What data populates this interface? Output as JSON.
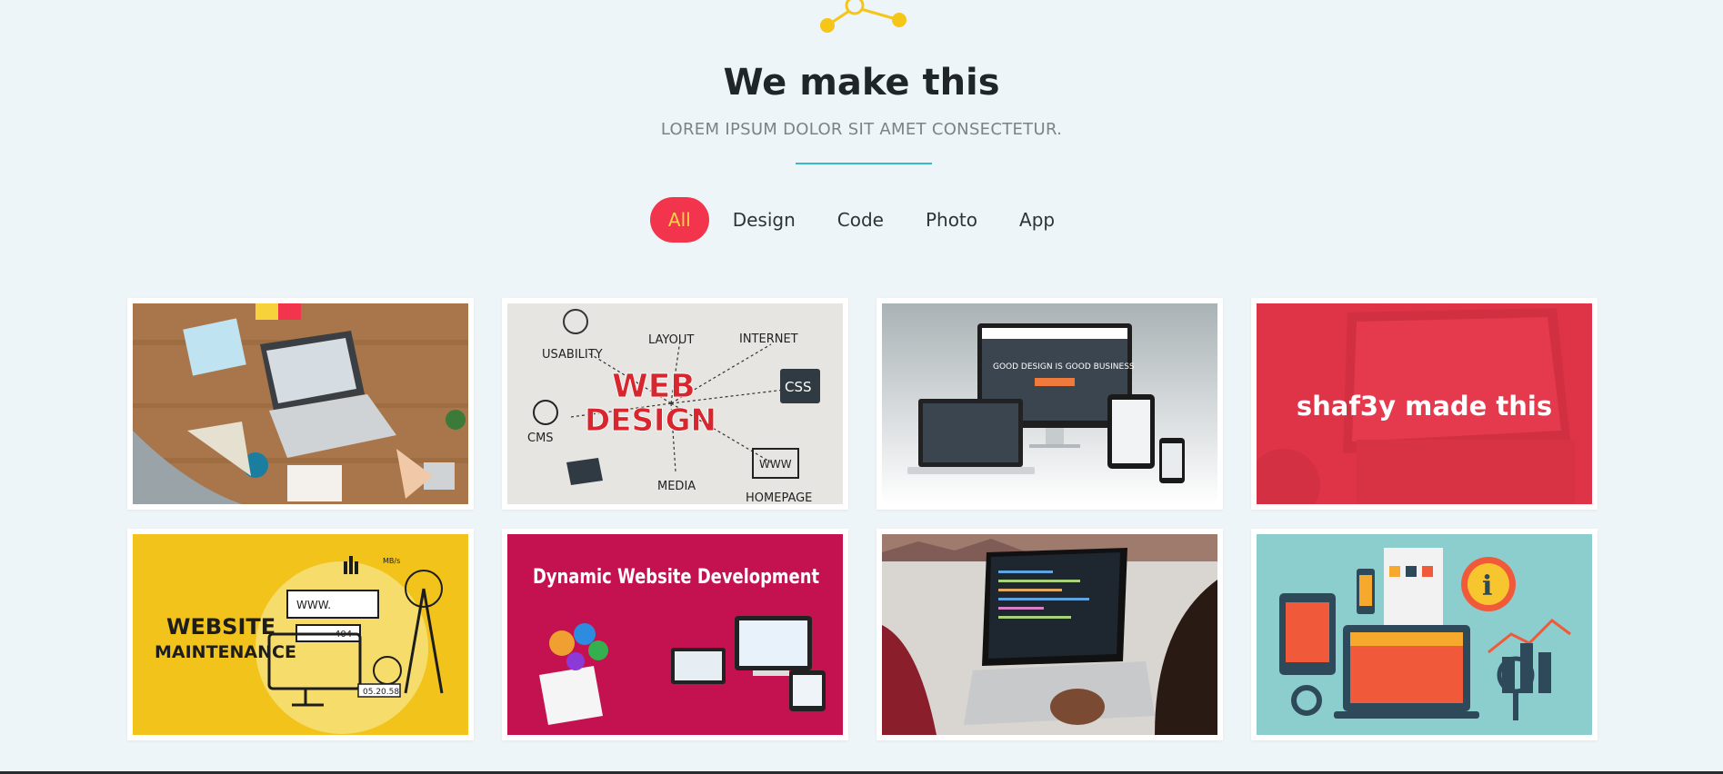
{
  "header": {
    "title": "We make this",
    "subtitle": "LOREM IPSUM DOLOR SIT AMET CONSECTETUR."
  },
  "filters": [
    {
      "label": "All",
      "active": true
    },
    {
      "label": "Design",
      "active": false
    },
    {
      "label": "Code",
      "active": false
    },
    {
      "label": "Photo",
      "active": false
    },
    {
      "label": "App",
      "active": false
    }
  ],
  "portfolio": {
    "hover_caption": "shaf3y made this",
    "items": [
      {
        "image": "workspace-desk-laptop"
      },
      {
        "image": "web-design-diagram",
        "text": {
          "usability": "USABILITY",
          "layout": "LAYOUT",
          "internet": "INTERNET",
          "web": "WEB",
          "design": "DESIGN",
          "css": "CSS",
          "cms": "CMS",
          "media": "MEDIA",
          "www": "WWW",
          "homepage": "HOMEPAGE"
        }
      },
      {
        "image": "responsive-devices-mockup",
        "text": {
          "tagline": "GOOD DESIGN IS GOOD BUSINESS"
        }
      },
      {
        "image": "laptop-sunset-website-hovered"
      },
      {
        "image": "website-maintenance-illustration",
        "text": {
          "line1": "WEBSITE",
          "line2": "MAINTENANCE",
          "www": "WWW.",
          "code": "404",
          "date": "05.20.58",
          "mbs": "MB/s"
        }
      },
      {
        "image": "dynamic-website-development-banner",
        "text": {
          "headline": "Dynamic Website Development"
        }
      },
      {
        "image": "coding-on-laptop-photo"
      },
      {
        "image": "info-graphics-devices-illustration"
      }
    ]
  },
  "colors": {
    "background": "#eef5f8",
    "accent": "#f2354c",
    "active_text": "#ffd24a",
    "divider": "#3bb7c7",
    "logo": "#f5c518"
  }
}
